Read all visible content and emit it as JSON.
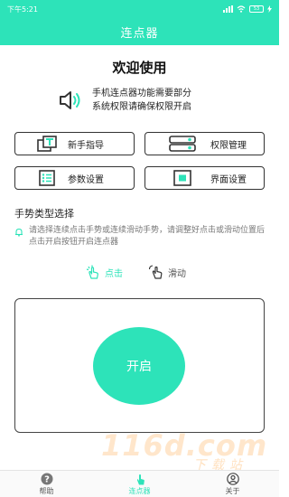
{
  "status_bar": {
    "time": "下午5:21",
    "battery": "53"
  },
  "app_bar": {
    "title": "连点器"
  },
  "welcome": {
    "title": "欢迎使用"
  },
  "notice": {
    "line1": "手机连点器功能需要部分",
    "line2": "系统权限请确保权限开启",
    "icon": "speaker-icon"
  },
  "buttons": {
    "guide": "新手指导",
    "permission": "权限管理",
    "params": "参数设置",
    "ui": "界面设置"
  },
  "gesture_section": {
    "title": "手势类型选择",
    "hint": "请选择连续点击手势或连续滑动手势，请调整好点击或滑动位置后点击开启按钮开启连点器",
    "tap_label": "点击",
    "swipe_label": "滑动",
    "selected": "点击"
  },
  "start_button": {
    "label": "开启"
  },
  "watermark": {
    "main": "116d.com",
    "sub": "下载站"
  },
  "bottom_nav": {
    "help": "帮助",
    "clicker": "连点器",
    "about": "关于",
    "active": "连点器"
  },
  "colors": {
    "accent": "#2de3b9",
    "text": "#222222",
    "hint": "#777777"
  }
}
